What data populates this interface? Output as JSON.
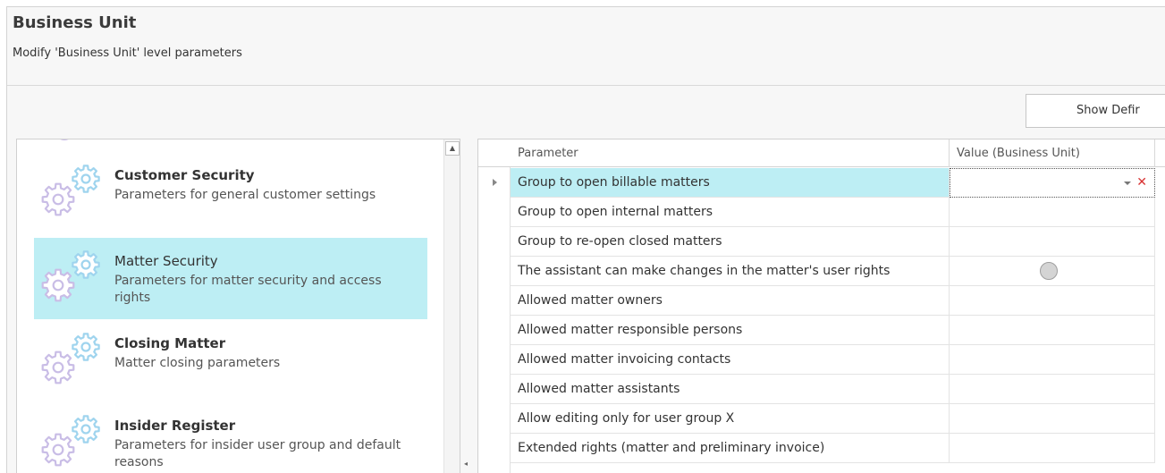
{
  "header": {
    "title": "Business Unit",
    "subtitle": "Modify 'Business Unit' level parameters"
  },
  "toolbar": {
    "show_definitions_label": "Show Defir"
  },
  "categories": [
    {
      "title": "Customer Security",
      "description": "Parameters for general customer settings",
      "bold": true,
      "selected": false
    },
    {
      "title": "Matter Security",
      "description": "Parameters for matter security and access rights",
      "bold": false,
      "selected": true
    },
    {
      "title": "Closing Matter",
      "description": "Matter closing parameters",
      "bold": true,
      "selected": false
    },
    {
      "title": "Insider Register",
      "description": "Parameters for insider user group and default reasons",
      "bold": true,
      "selected": false
    }
  ],
  "grid": {
    "columns": [
      "Parameter",
      "Value (Business Unit)"
    ],
    "rows": [
      {
        "parameter": "Group to open billable matters",
        "value_type": "dropdown",
        "selected": true
      },
      {
        "parameter": "Group to open internal matters",
        "value_type": "empty"
      },
      {
        "parameter": "Group to re-open closed matters",
        "value_type": "empty"
      },
      {
        "parameter": "The assistant can make changes in the matter's user rights",
        "value_type": "radio"
      },
      {
        "parameter": "Allowed matter owners",
        "value_type": "empty"
      },
      {
        "parameter": "Allowed matter responsible persons",
        "value_type": "empty"
      },
      {
        "parameter": "Allowed matter invoicing contacts",
        "value_type": "empty"
      },
      {
        "parameter": "Allowed matter assistants",
        "value_type": "empty"
      },
      {
        "parameter": "Allow editing only for user group X",
        "value_type": "empty"
      },
      {
        "parameter": "Extended rights (matter and preliminary invoice)",
        "value_type": "empty"
      }
    ]
  },
  "icons": {
    "gear_large": "gear-icon",
    "gear_small": "gear-icon",
    "row_indicator": "caret-right-icon",
    "dropdown": "chevron-down-icon",
    "clear": "close-icon",
    "scroll_up": "arrow-up-icon",
    "scroll_left": "arrow-left-icon"
  },
  "colors": {
    "selection": "#bdeef4",
    "gear_purple": "#c9bde6",
    "gear_blue": "#9fd4ee",
    "clear_red": "#d83232"
  }
}
